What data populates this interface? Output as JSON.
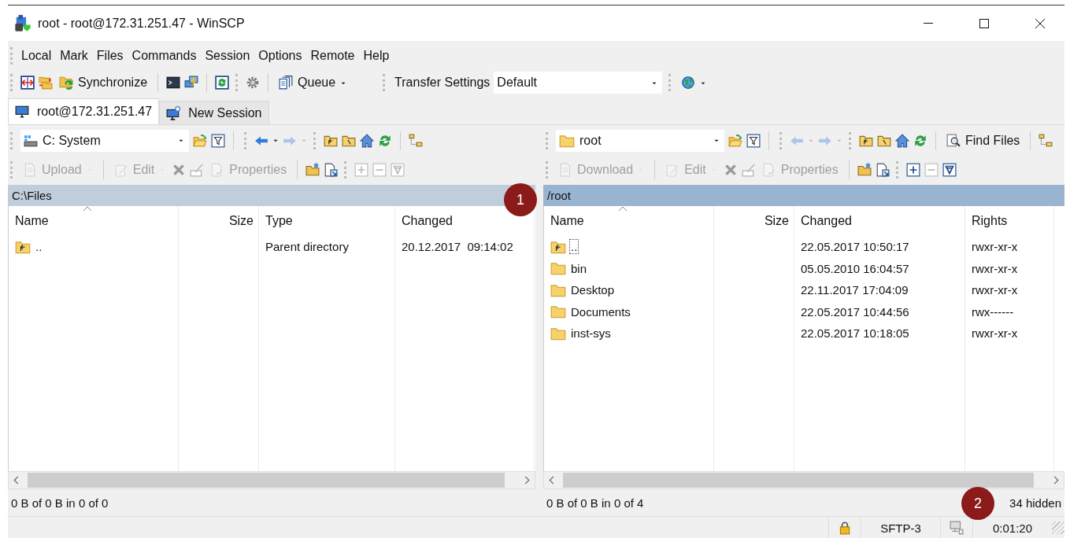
{
  "window": {
    "title": "root - root@172.31.251.47 - WinSCP"
  },
  "menu": [
    {
      "label": "Local"
    },
    {
      "label": "Mark"
    },
    {
      "label": "Files"
    },
    {
      "label": "Commands"
    },
    {
      "label": "Session"
    },
    {
      "label": "Options"
    },
    {
      "label": "Remote"
    },
    {
      "label": "Help"
    }
  ],
  "toolbar": {
    "synchronize": "Synchronize",
    "queue": "Queue",
    "transfer_settings_label": "Transfer Settings",
    "transfer_settings_value": "Default"
  },
  "tabs": [
    {
      "label": "root@172.31.251.47",
      "selected": true
    },
    {
      "label": "New Session",
      "selected": false
    }
  ],
  "panels": [
    {
      "location": {
        "kind": "drive",
        "text": "C: System"
      },
      "back_disabled": false,
      "forward_disabled": true,
      "active": false,
      "file_actions": [
        {
          "label": "Upload",
          "disabled": true
        },
        {
          "label": "Edit",
          "disabled": true
        },
        {
          "label": "Properties",
          "disabled": true
        }
      ],
      "mark_buttons": [
        {
          "disabled": true
        },
        {
          "disabled": true
        },
        {
          "disabled": true
        }
      ],
      "path": "C:\\Files",
      "columns": [
        {
          "label": "Name",
          "sorted": true
        },
        {
          "label": "Size",
          "sorted": false
        },
        {
          "label": "Type",
          "sorted": false
        },
        {
          "label": "Changed",
          "sorted": false
        }
      ],
      "rows": [
        {
          "kind": "parent",
          "focused": false,
          "cells": [
            "..",
            "",
            "Parent directory",
            "20.12.2017  09:14:02"
          ]
        }
      ],
      "status": "0 B of 0 B in 0 of 0"
    },
    {
      "location": {
        "kind": "folder",
        "text": "root"
      },
      "back_disabled": true,
      "forward_disabled": true,
      "active": true,
      "find_files": "Find Files",
      "file_actions": [
        {
          "label": "Download",
          "disabled": true
        },
        {
          "label": "Edit",
          "disabled": true
        },
        {
          "label": "Properties",
          "disabled": true
        }
      ],
      "mark_buttons": [
        {
          "disabled": false
        },
        {
          "disabled": true
        },
        {
          "disabled": false
        }
      ],
      "path": "/root",
      "columns": [
        {
          "label": "Name",
          "sorted": true
        },
        {
          "label": "Size",
          "sorted": false
        },
        {
          "label": "Changed",
          "sorted": false
        },
        {
          "label": "Rights",
          "sorted": false
        }
      ],
      "rows": [
        {
          "kind": "parent",
          "focused": true,
          "cells": [
            "..",
            "",
            "22.05.2017 10:50:17",
            "rwxr-xr-x"
          ]
        },
        {
          "kind": "folder",
          "focused": false,
          "cells": [
            "bin",
            "",
            "05.05.2010 16:04:57",
            "rwxr-xr-x"
          ]
        },
        {
          "kind": "folder",
          "focused": false,
          "cells": [
            "Desktop",
            "",
            "22.11.2017 17:04:09",
            "rwxr-xr-x"
          ]
        },
        {
          "kind": "folder",
          "focused": false,
          "cells": [
            "Documents",
            "",
            "22.05.2017 10:44:56",
            "rwx------"
          ]
        },
        {
          "kind": "folder",
          "focused": false,
          "cells": [
            "inst-sys",
            "",
            "22.05.2017 10:18:05",
            "rwxr-xr-x"
          ]
        }
      ],
      "status": "0 B of 0 B in 0 of 4",
      "hidden": "34 hidden"
    }
  ],
  "status_bar": {
    "protocol": "SFTP-3",
    "elapsed": "0:01:20"
  },
  "callouts": [
    {
      "number": "1"
    },
    {
      "number": "2"
    }
  ]
}
